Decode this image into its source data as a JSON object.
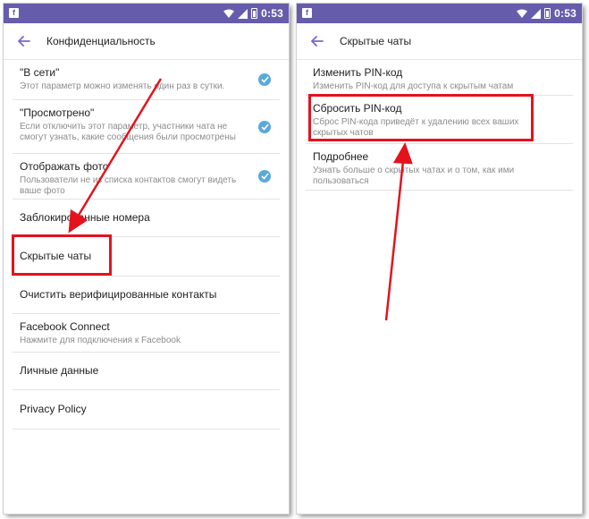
{
  "status_bar": {
    "time": "0:53",
    "left_icon": "notification-icon",
    "icons": [
      "wifi-icon",
      "signal-icon",
      "battery-icon"
    ]
  },
  "left_screen": {
    "title": "Конфиденциальность",
    "items": [
      {
        "title": "\"В сети\"",
        "subtitle": "Этот параметр можно изменять один раз в сутки.",
        "checked": true
      },
      {
        "title": "\"Просмотрено\"",
        "subtitle": "Если отключить этот параметр, участники чата не смогут узнать, какие сообщения были просмотрены",
        "checked": true
      },
      {
        "title": "Отображать фото",
        "subtitle": "Пользователи не из списка контактов смогут видеть ваше фото",
        "checked": true
      },
      {
        "title": "Заблокированные номера"
      },
      {
        "title": "Скрытые чаты"
      },
      {
        "title": "Очистить верифицированные контакты"
      },
      {
        "title": "Facebook Connect",
        "subtitle": "Нажмите для подключения к Facebook"
      },
      {
        "title": "Личные данные"
      },
      {
        "title": "Privacy Policy"
      }
    ]
  },
  "right_screen": {
    "title": "Скрытые чаты",
    "items": [
      {
        "title": "Изменить PIN-код",
        "subtitle": "Изменить PIN-код для доступа к скрытым чатам"
      },
      {
        "title": "Сбросить PIN-код",
        "subtitle": "Сброс PIN-кода приведёт к удалению всех ваших скрытых чатов"
      },
      {
        "title": "Подробнее",
        "subtitle": "Узнать больше о скрытых чатах и о том, как ими пользоваться"
      }
    ]
  },
  "colors": {
    "status_bar": "#665cac",
    "accent": "#7b68c8",
    "checkbox": "#5aa9dc",
    "annotation": "#e3131d"
  }
}
